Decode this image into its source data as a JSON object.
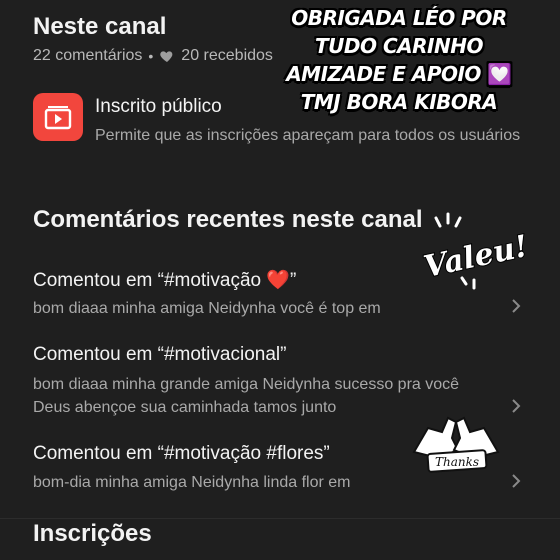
{
  "channel": {
    "title": "Neste canal",
    "comments_count": "22 comentários",
    "separator": "•",
    "received": "20 recebidos"
  },
  "subscription": {
    "title": "Inscrito público",
    "description": "Permite que as inscrições apareçam para todos os usuários"
  },
  "recent": {
    "heading": "Comentários recentes neste canal",
    "items": [
      {
        "title": "Comentou em “#motivação ❤️”",
        "body": "bom diaaa minha amiga Neidynha você é top em"
      },
      {
        "title": "Comentou em “#motivacional”",
        "body": "bom diaaa minha grande amiga Neidynha sucesso pra você Deus abençoe sua caminhada tamos junto"
      },
      {
        "title": "Comentou em “#motivação #flores”",
        "body": "bom-dia minha amiga Neidynha linda flor em"
      }
    ]
  },
  "inscricoes": {
    "heading": "Inscrições"
  },
  "overlay": {
    "text_1": "OBRIGADA LÉO POR TUDO CARINHO AMIZADE E APOIO",
    "emoji": "💟",
    "text_2": "TMJ BORA KIBORA"
  },
  "stickers": {
    "valeu": "Valeu!",
    "thanks": "Thanks"
  },
  "colors": {
    "background": "#1f1f1f",
    "subscribe_icon": "#f2463d",
    "secondary_text": "#a9a9a9"
  }
}
